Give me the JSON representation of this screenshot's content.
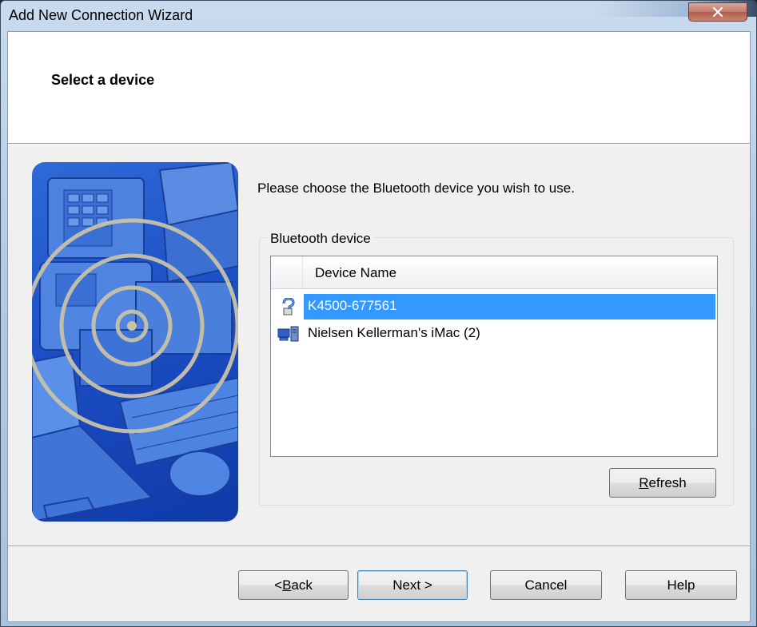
{
  "window": {
    "title": "Add New Connection Wizard"
  },
  "header": {
    "title": "Select a device"
  },
  "main": {
    "prompt": "Please choose the Bluetooth device you wish to use.",
    "group_label": "Bluetooth device",
    "list": {
      "column_header": "Device Name",
      "items": [
        {
          "label": "K4500-677561",
          "icon": "unknown-device-icon",
          "selected": true
        },
        {
          "label": "Nielsen Kellerman's iMac (2)",
          "icon": "computer-icon",
          "selected": false
        }
      ]
    },
    "refresh_prefix": "",
    "refresh_mnemonic": "R",
    "refresh_rest": "efresh"
  },
  "footer": {
    "back_prefix": "< ",
    "back_mnemonic": "B",
    "back_rest": "ack",
    "next_label": "Next >",
    "cancel_label": "Cancel",
    "help_label": "Help"
  },
  "colors": {
    "selection": "#3399ff",
    "dialog_bg": "#f0f0f0",
    "illustration": "#1c4fc4"
  }
}
